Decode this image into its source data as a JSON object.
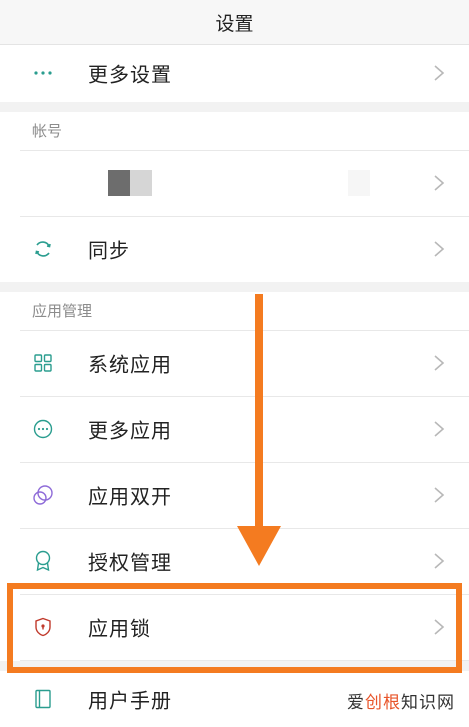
{
  "header": {
    "title": "设置"
  },
  "items": {
    "more_settings": {
      "label": "更多设置",
      "icon": "ellipsis-icon"
    },
    "sync": {
      "label": "同步",
      "icon": "sync-icon"
    },
    "system_apps": {
      "label": "系统应用",
      "icon": "grid-icon"
    },
    "more_apps": {
      "label": "更多应用",
      "icon": "more-circle-icon"
    },
    "dual_apps": {
      "label": "应用双开",
      "icon": "dual-circle-icon"
    },
    "permissions": {
      "label": "授权管理",
      "icon": "award-icon"
    },
    "app_lock": {
      "label": "应用锁",
      "icon": "shield-lock-icon"
    },
    "user_manual": {
      "label": "用户手册",
      "icon": "book-icon"
    }
  },
  "sections": {
    "account": {
      "title": "帐号"
    },
    "app_management": {
      "title": "应用管理"
    }
  },
  "annotation": {
    "color": "#F47B20",
    "highlight_target": "应用锁"
  },
  "watermark": {
    "part1": "爱",
    "part2": "创根",
    "part3": "知识网"
  },
  "colors": {
    "accent": "#2a9d8f",
    "purple": "#8e6bd8",
    "lock_red": "#c0392b",
    "chevron": "#b8b8b8"
  }
}
